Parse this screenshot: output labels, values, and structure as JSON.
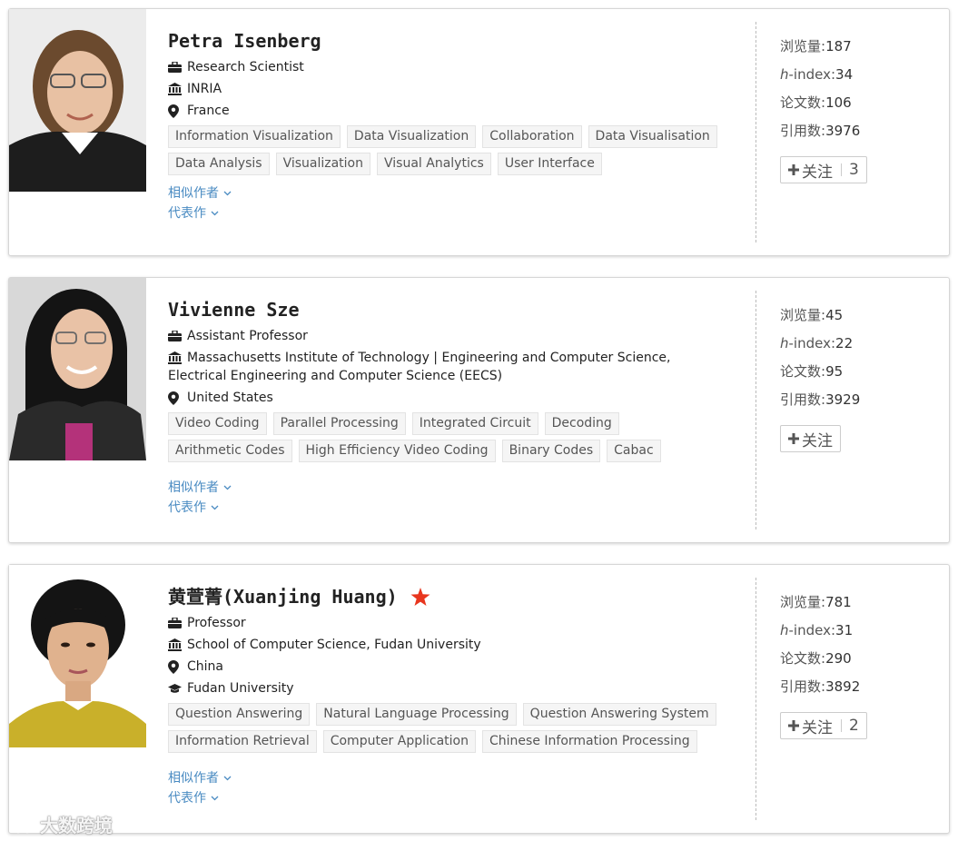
{
  "labels": {
    "similar_authors": "相似作者",
    "representative_works": "代表作",
    "views": "浏览量:",
    "h_prefix": "h",
    "h_suffix": "-index:",
    "papers": "论文数:",
    "citations": "引用数:",
    "follow": "关注"
  },
  "authors": [
    {
      "name": "Petra Isenberg",
      "title": "Research Scientist",
      "affiliation": "INRIA",
      "location": "France",
      "tags": [
        "Information Visualization",
        "Data Visualization",
        "Collaboration",
        "Data Visualisation",
        "Data Analysis",
        "Visualization",
        "Visual Analytics",
        "User Interface"
      ],
      "views": "187",
      "h_index": "34",
      "papers": "106",
      "citations": "3976",
      "followers": "3"
    },
    {
      "name": "Vivienne Sze",
      "title": "Assistant Professor",
      "affiliation": "Massachusetts Institute of Technology | Engineering and Computer Science, Electrical Engineering and Computer Science (EECS)",
      "location": "United States",
      "tags": [
        "Video Coding",
        "Parallel Processing",
        "Integrated Circuit",
        "Decoding",
        "Arithmetic Codes",
        "High Efficiency Video Coding",
        "Binary Codes",
        "Cabac"
      ],
      "views": "45",
      "h_index": "22",
      "papers": "95",
      "citations": "3929",
      "followers": ""
    },
    {
      "name": "黄萱菁(Xuanjing Huang)",
      "title": "Professor",
      "affiliation": "School of Computer Science, Fudan University",
      "location": "China",
      "education": "Fudan University",
      "tags": [
        "Question Answering",
        "Natural Language Processing",
        "Question Answering System",
        "Information Retrieval",
        "Computer Application",
        "Chinese Information Processing"
      ],
      "views": "781",
      "h_index": "31",
      "papers": "290",
      "citations": "3892",
      "followers": "2"
    }
  ],
  "watermark": "大数跨境",
  "colors": {
    "link": "#4a8bc2",
    "star": "#e8361e",
    "tag_bg": "#f5f5f5",
    "tag_border": "#e3e3e3"
  },
  "icons": [
    "briefcase-icon",
    "institution-icon",
    "location-pin-icon",
    "graduation-cap-icon",
    "chevron-down-icon",
    "plus-icon",
    "star-icon"
  ]
}
